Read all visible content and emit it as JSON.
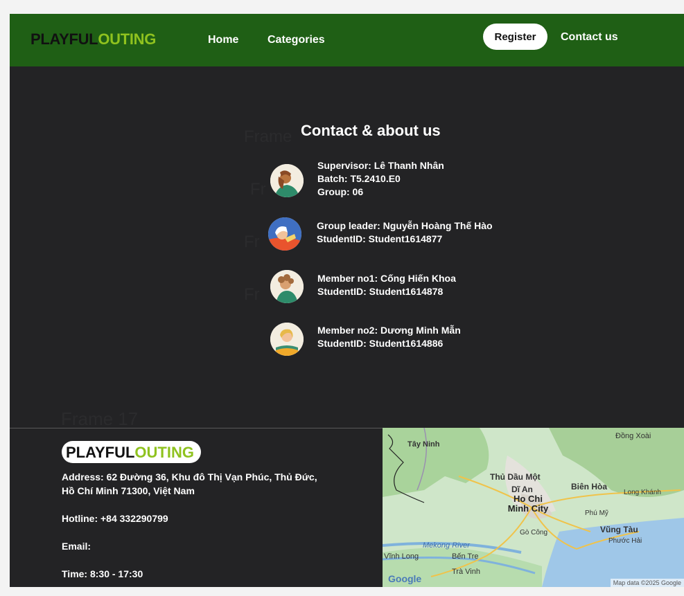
{
  "nav": {
    "brand_part1": "PLAYFUL",
    "brand_part2": "OUTING",
    "home": "Home",
    "categories": "Categories",
    "register": "Register",
    "contact": "Contact us"
  },
  "ghost_labels": {
    "frame_a": "Frame",
    "frame_b": "Fr",
    "frame_c": "Fr",
    "frame_d": "Fr",
    "frame_17": "Frame 17"
  },
  "contact": {
    "title": "Contact & about us",
    "members": [
      {
        "line1": "Supervisor: Lê Thanh Nhân",
        "line2": "Batch: T5.2410.E0",
        "line3": "Group: 06",
        "icon": "person-icon"
      },
      {
        "line1": "Group  leader:  Nguyễn Hoàng Thế Hào",
        "line2": "StudentID: Student1614877",
        "icon": "person-icon"
      },
      {
        "line1": "Member no1: Cống Hiến Khoa",
        "line2": "StudentID: Student1614878",
        "icon": "person-icon"
      },
      {
        "line1": "Member no2: Dương Minh Mẫn",
        "line2": "StudentID: Student1614886",
        "icon": "person-icon"
      }
    ]
  },
  "footer": {
    "brand_part1": "PLAYFUL",
    "brand_part2": "OUTING",
    "address_line1": "Address: 62 Đường 36, Khu đô Thị Vạn Phúc, Thủ Đức,",
    "address_line2": "Hồ Chí Minh 71300, Việt Nam",
    "hotline": "Hotline: +84 332290799",
    "email": "Email:",
    "time": "Time: 8:30 - 17:30"
  },
  "map": {
    "labels": {
      "tay_ninh": "Tây Ninh",
      "dong_xoai": "Đồng Xoài",
      "thu_dau_mot": "Thủ Dầu Một",
      "bien_hoa": "Biên Hòa",
      "di_an": "Dĩ An",
      "long_khanh": "Long Khánh",
      "hcm_line1": "Ho Chi",
      "hcm_line2": "Minh City",
      "phu_my": "Phú Mỹ",
      "go_cong": "Gò Công",
      "vung_tau": "Vũng Tàu",
      "phuoc_hai": "Phước Hải",
      "mekong": "Mekong River",
      "vinh_long": "Vĩnh Long",
      "ben_tre": "Bến Tre",
      "tra_vinh": "Trà Vinh"
    },
    "logo": "Google",
    "attribution": "Map data ©2025 Google"
  },
  "colors": {
    "navbar": "#1f5f15",
    "page": "#232325",
    "accent": "#8fc21f"
  }
}
